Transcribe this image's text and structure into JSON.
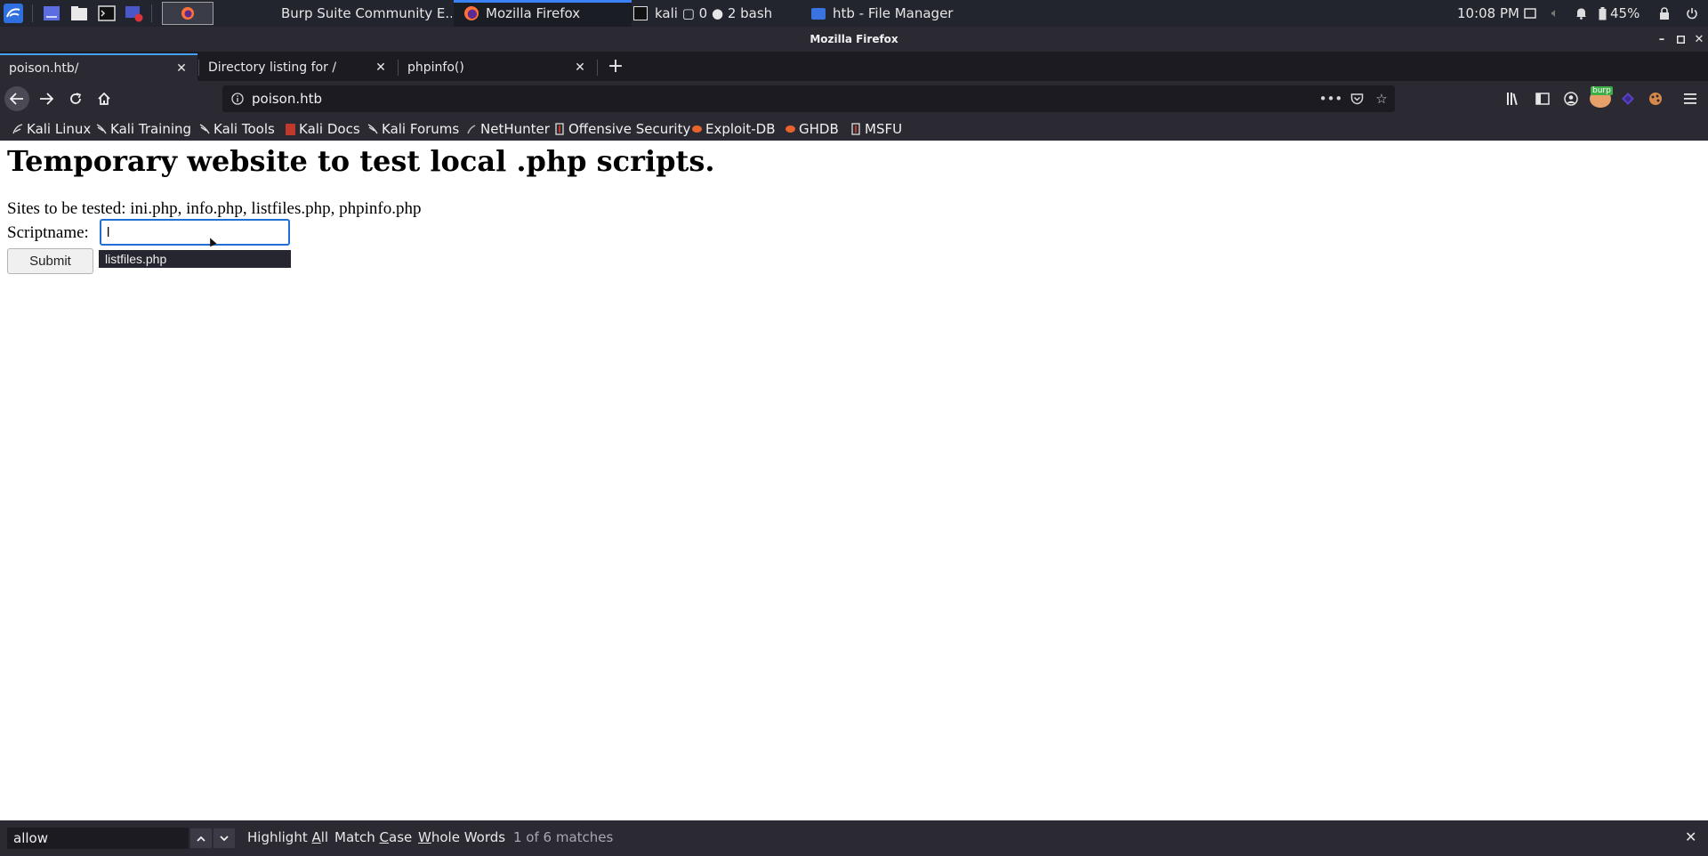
{
  "taskbar": {
    "tasks": [
      {
        "label": "Burp Suite Community E...",
        "icon": "burp-icon"
      },
      {
        "label": "Mozilla Firefox",
        "icon": "firefox-icon",
        "active": true
      },
      {
        "label": "kali ▢ 0 ● 2 bash",
        "icon": "terminal-icon"
      },
      {
        "label": "htb - File Manager",
        "icon": "folder-icon"
      }
    ],
    "clock": "10:08 PM",
    "battery": "45%"
  },
  "window": {
    "title": "Mozilla Firefox"
  },
  "tabs": [
    {
      "label": "poison.htb/",
      "active": true
    },
    {
      "label": "Directory listing for /",
      "active": false
    },
    {
      "label": "phpinfo()",
      "active": false
    }
  ],
  "urlbar": {
    "url": "poison.htb"
  },
  "toolbar": {
    "burp_badge": "burp"
  },
  "bookmarks": [
    {
      "label": "Kali Linux",
      "icon": "kali-dragon-icon"
    },
    {
      "label": "Kali Training",
      "icon": "kali-dragon-icon"
    },
    {
      "label": "Kali Tools",
      "icon": "kali-dragon-icon"
    },
    {
      "label": "Kali Docs",
      "icon": "kali-docs-icon"
    },
    {
      "label": "Kali Forums",
      "icon": "kali-dragon-icon"
    },
    {
      "label": "NetHunter",
      "icon": "nethunter-icon"
    },
    {
      "label": "Offensive Security",
      "icon": "offsec-icon"
    },
    {
      "label": "Exploit-DB",
      "icon": "exploitdb-icon"
    },
    {
      "label": "GHDB",
      "icon": "ghdb-icon"
    },
    {
      "label": "MSFU",
      "icon": "msfu-icon"
    }
  ],
  "page": {
    "heading": "Temporary website to test local .php scripts.",
    "sites_text": "Sites to be tested: ini.php, info.php, listfiles.php, phpinfo.php",
    "script_label": "Scriptname:",
    "script_value": "l",
    "autocomplete_suggestion": "listfiles.php",
    "submit_label": "Submit"
  },
  "findbar": {
    "query": "allow",
    "highlight_all_prefix": "Highlight ",
    "highlight_all_ul": "A",
    "highlight_all_suffix": "ll",
    "match_case_prefix": "Match ",
    "match_case_ul": "C",
    "match_case_suffix": "ase",
    "whole_words_ul": "W",
    "whole_words_suffix": "hole Words",
    "status": "1 of 6 matches"
  },
  "colors": {
    "accent": "#45a1ff",
    "taskbar_bg": "#23252e",
    "chrome_bg": "#2b2a33",
    "tabstrip_bg": "#1c1b22"
  }
}
